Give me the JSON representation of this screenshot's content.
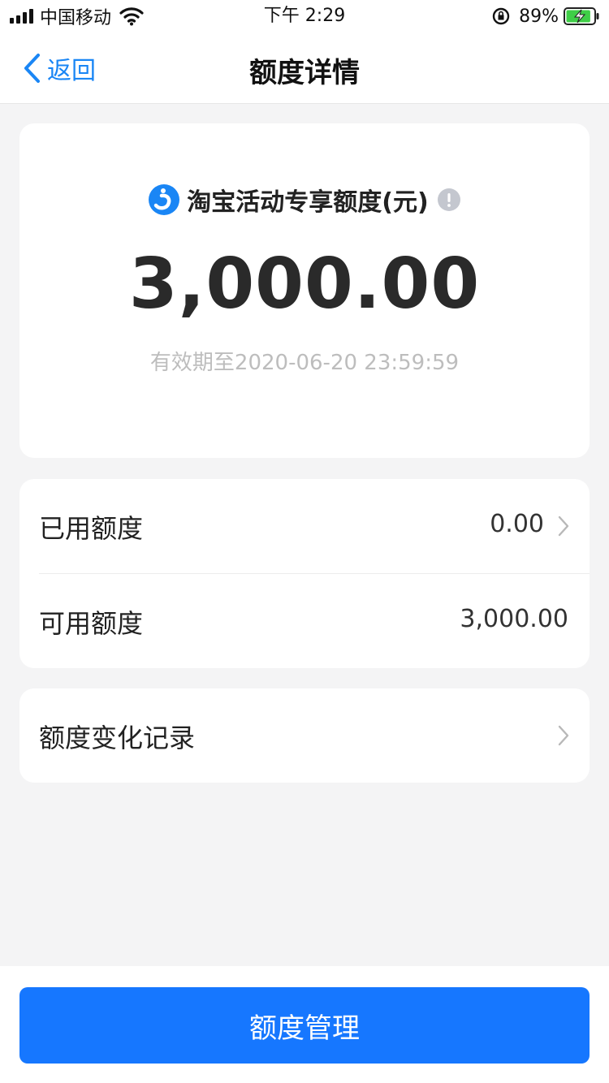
{
  "status_bar": {
    "carrier": "中国移动",
    "time": "下午 2:29",
    "battery_percent": "89%",
    "battery_level": 0.89,
    "icons": [
      "signal-icon",
      "wifi-icon",
      "orientation-lock-icon",
      "battery-charging-icon"
    ]
  },
  "nav": {
    "back_label": "返回",
    "title": "额度详情"
  },
  "quota_card": {
    "title": "淘宝活动专享额度(元)",
    "amount": "3,000.00",
    "expiry": "有效期至2020-06-20 23:59:59",
    "logo_color": "#1a86f5"
  },
  "details": {
    "used_label": "已用额度",
    "used_value": "0.00",
    "available_label": "可用额度",
    "available_value": "3,000.00"
  },
  "history": {
    "label": "额度变化记录"
  },
  "footer": {
    "manage_label": "额度管理"
  },
  "colors": {
    "accent": "#1677ff",
    "link": "#1a86f5",
    "background": "#f4f4f5"
  }
}
